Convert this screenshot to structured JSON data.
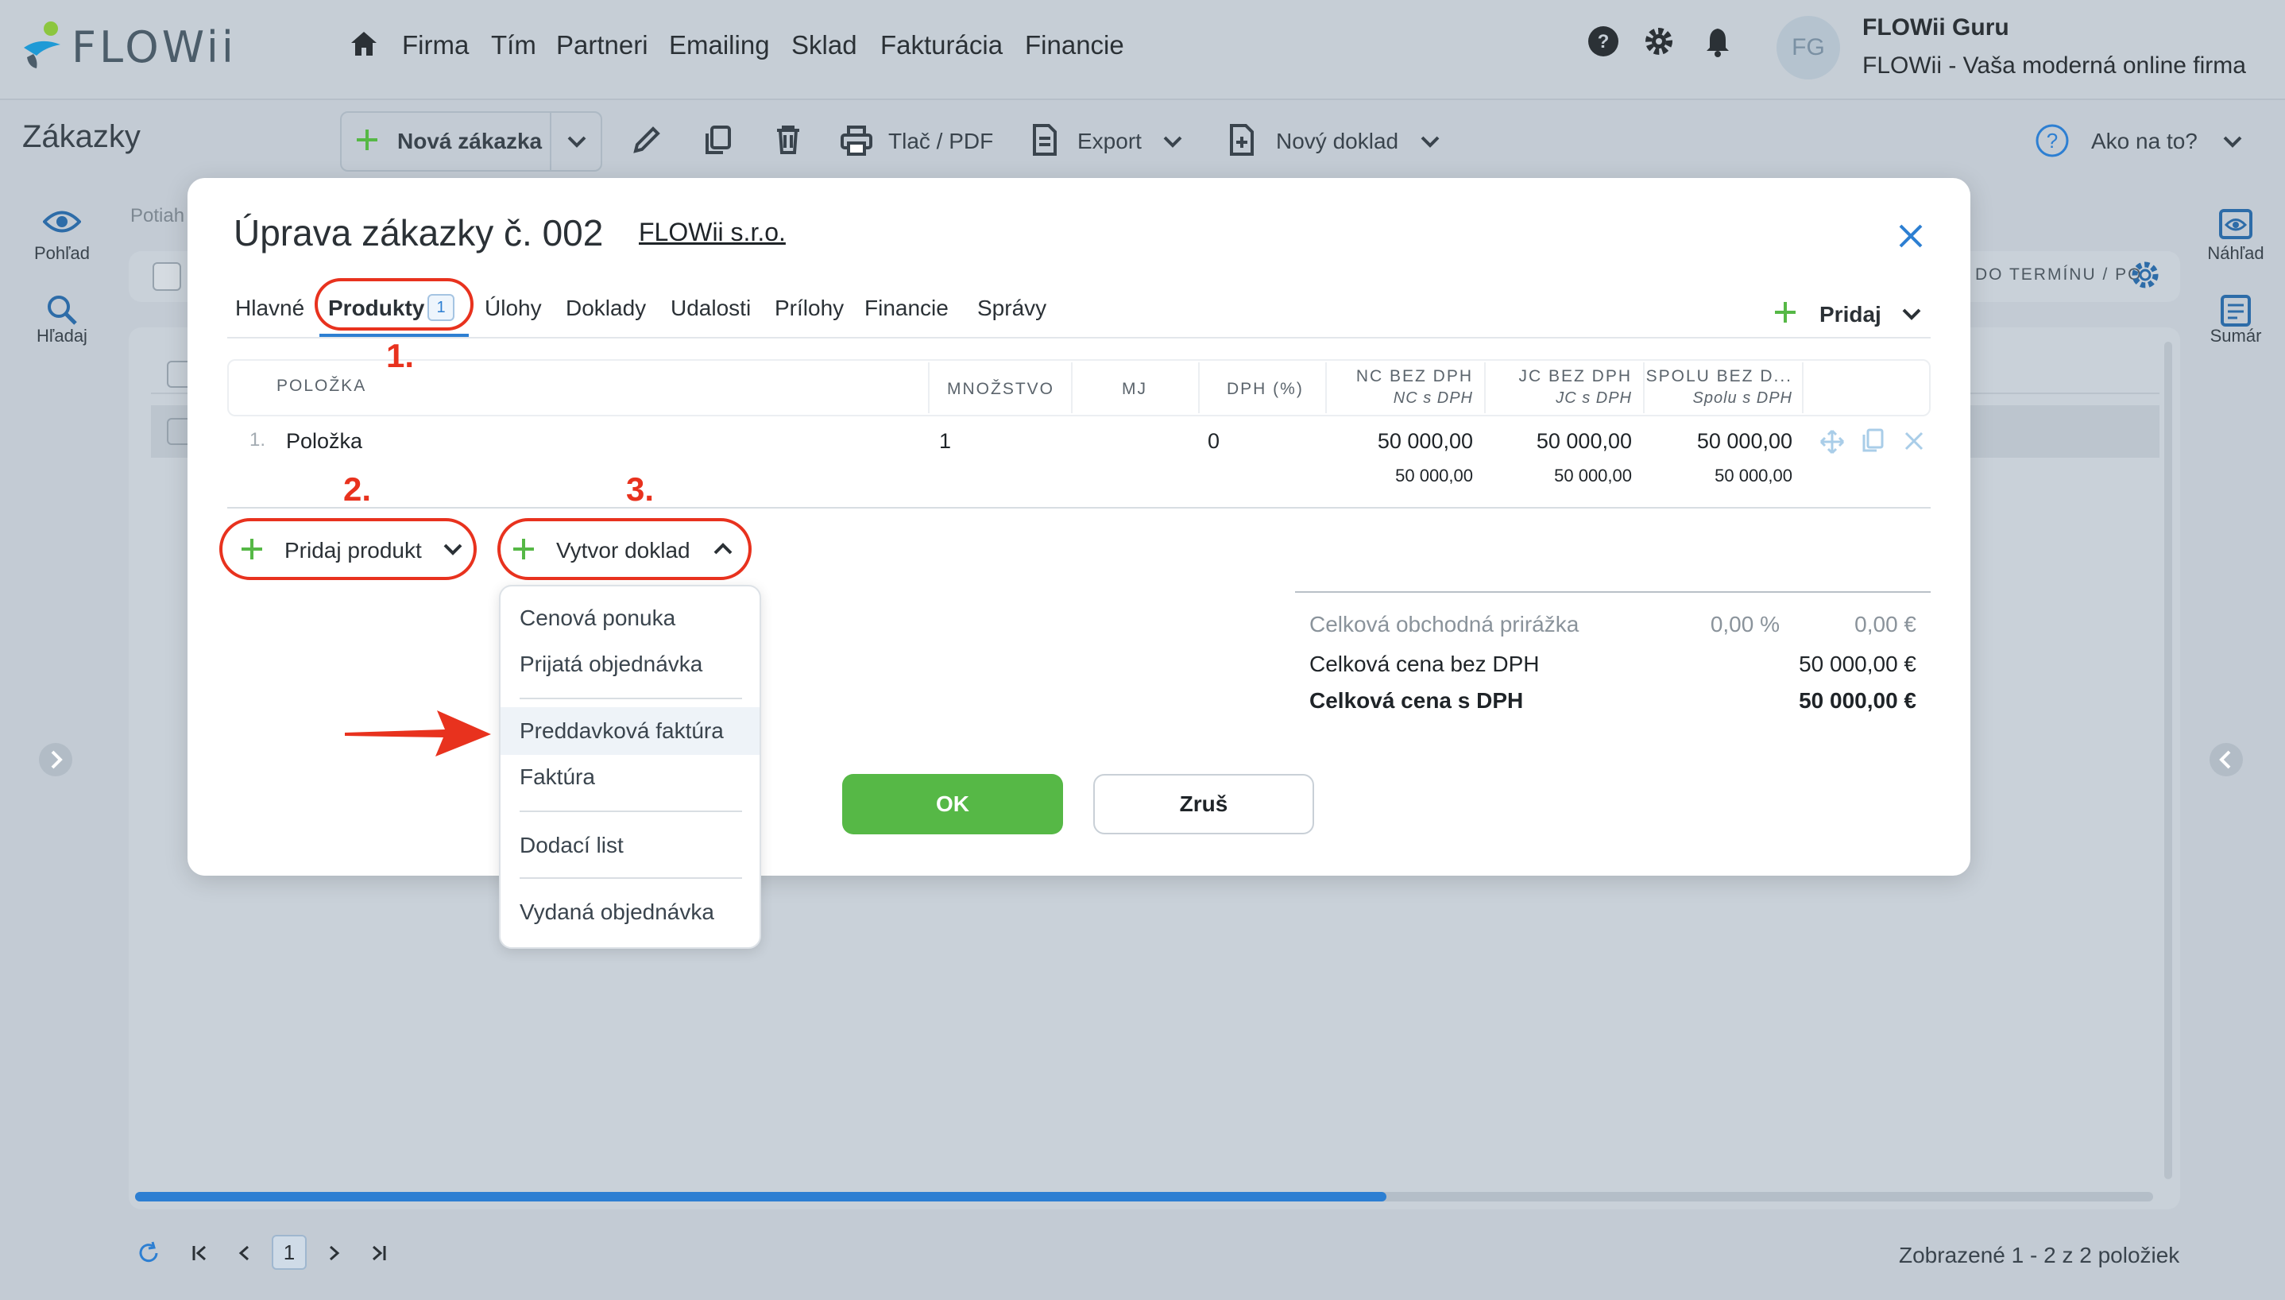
{
  "app": {
    "logo_text": "FLOWii",
    "nav": [
      "Firma",
      "Tím",
      "Partneri",
      "Emailing",
      "Sklad",
      "Fakturácia",
      "Financie"
    ],
    "user": {
      "initials": "FG",
      "name": "FLOWii Guru",
      "subtitle": "FLOWii - Vaša moderná online firma"
    }
  },
  "toolbar": {
    "page_title": "Zákazky",
    "new_order": "Nová zákazka",
    "print_pdf": "Tlač / PDF",
    "export": "Export",
    "new_doc": "Nový doklad",
    "help": "Ako na to?"
  },
  "left_rail": {
    "view": "Pohľad",
    "search": "Hľadaj"
  },
  "right_rail": {
    "preview": "Náhľad",
    "summary": "Sumár"
  },
  "background": {
    "breadcrumb_hint": "Potiah",
    "column_hint": "DO TERMÍNU / PO",
    "footer_text": "Zobrazené 1 - 2 z 2 položiek",
    "page_number": "1",
    "scroll_progress": 0.62
  },
  "modal": {
    "title": "Úprava zákazky č. 002",
    "company": "FLOWii s.r.o.",
    "tabs": [
      {
        "label": "Hlavné"
      },
      {
        "label": "Produkty",
        "badge": "1",
        "active": true
      },
      {
        "label": "Úlohy"
      },
      {
        "label": "Doklady"
      },
      {
        "label": "Udalosti"
      },
      {
        "label": "Prílohy"
      },
      {
        "label": "Financie"
      },
      {
        "label": "Správy"
      }
    ],
    "add_label": "Pridaj",
    "table": {
      "headers": {
        "item": "POLOŽKA",
        "qty": "MNOŽSTVO",
        "unit": "MJ",
        "vat": "DPH (%)",
        "nc": "NC BEZ DPH",
        "nc_sub": "NC s DPH",
        "jc": "JC BEZ DPH",
        "jc_sub": "JC s DPH",
        "total": "SPOLU BEZ D...",
        "total_sub": "Spolu s DPH"
      },
      "rows": [
        {
          "index": "1.",
          "name": "Položka",
          "qty": "1",
          "unit": "",
          "vat": "0",
          "nc": "50 000,00",
          "nc_vat": "50 000,00",
          "jc": "50 000,00",
          "jc_vat": "50 000,00",
          "total": "50 000,00",
          "total_vat": "50 000,00"
        }
      ]
    },
    "add_product": "Pridaj produkt",
    "create_doc": "Vytvor doklad",
    "dropdown": [
      "Cenová ponuka",
      "Prijatá objednávka",
      "Preddavková faktúra",
      "Faktúra",
      "Dodací list",
      "Vydaná objednávka"
    ],
    "summary": {
      "markup_label": "Celková obchodná prirážka",
      "markup_pct": "0,00 %",
      "markup_val": "0,00 €",
      "net_label": "Celková cena bez DPH",
      "net_val": "50 000,00 €",
      "gross_label": "Celková cena s DPH",
      "gross_val": "50 000,00 €"
    },
    "ok": "OK",
    "cancel": "Zruš"
  },
  "annotations": {
    "a1": "1.",
    "a2": "2.",
    "a3": "3."
  },
  "colors": {
    "accent_green": "#56b846",
    "annotation_red": "#e8321e",
    "link_blue": "#2d7fd2"
  }
}
